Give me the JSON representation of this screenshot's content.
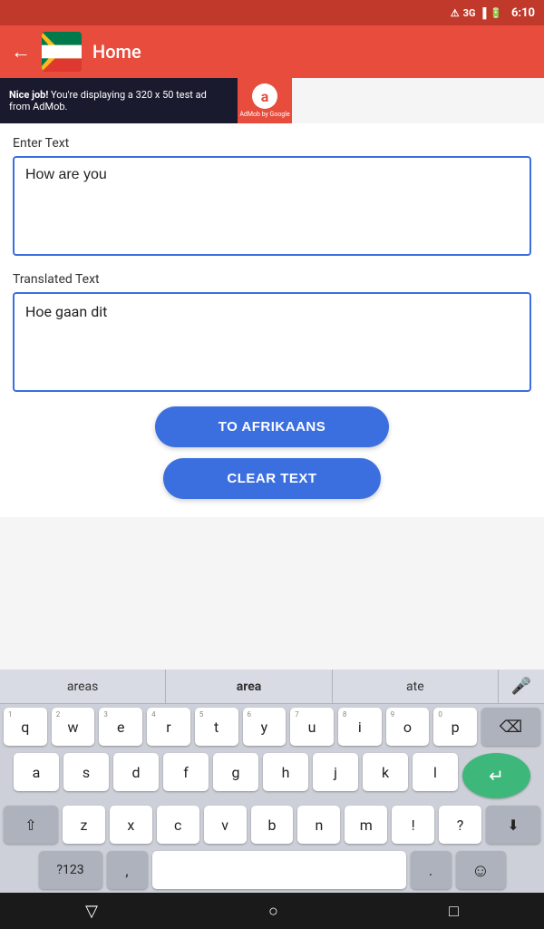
{
  "statusBar": {
    "network": "3G",
    "signalIcon": "signal-icon",
    "batteryIcon": "battery-icon",
    "time": "6:10"
  },
  "toolbar": {
    "backLabel": "←",
    "title": "Home"
  },
  "adBanner": {
    "text": "Nice job! You're displaying a 320 x 50 test ad from AdMob.",
    "logoLetter": "a",
    "poweredBy": "AdMob by Google"
  },
  "main": {
    "enterTextLabel": "Enter Text",
    "inputText": "How are you",
    "translatedTextLabel": "Translated Text",
    "translatedText": "Hoe gaan dit"
  },
  "buttons": {
    "toAfrikaans": "TO AFRIKAANS",
    "clearText": "CLEAR TEXT"
  },
  "keyboard": {
    "suggestions": [
      "areas",
      "area",
      "ate"
    ],
    "rows": [
      [
        "q",
        "w",
        "e",
        "r",
        "t",
        "y",
        "u",
        "i",
        "o",
        "p"
      ],
      [
        "a",
        "s",
        "d",
        "f",
        "g",
        "h",
        "j",
        "k",
        "l"
      ],
      [
        "z",
        "x",
        "c",
        "v",
        "b",
        "n",
        "m"
      ]
    ],
    "nums": [
      "1",
      "2",
      "3",
      "4",
      "5",
      "6",
      "7",
      "8",
      "9",
      "0"
    ],
    "numbersLabel": "?123",
    "commaLabel": ",",
    "periodLabel": ".",
    "returnIcon": "↵",
    "backspaceIcon": "⌫",
    "shiftUp": "⇧",
    "shiftDown": "⬇",
    "emojiIcon": "☺"
  },
  "bottomNav": {
    "backIcon": "▽",
    "homeIcon": "○",
    "recentIcon": "□"
  }
}
